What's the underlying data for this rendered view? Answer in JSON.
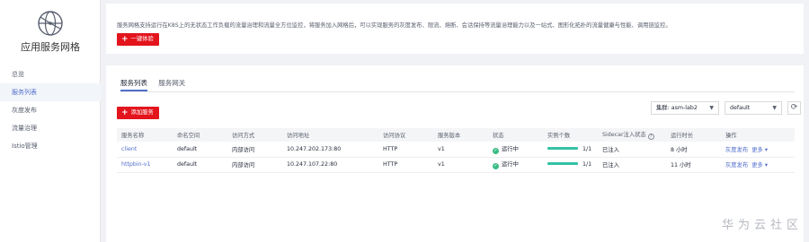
{
  "sidebar": {
    "title": "应用服务网格",
    "items": [
      {
        "label": "总览"
      },
      {
        "label": "服务列表",
        "active": true
      },
      {
        "label": "灰度发布"
      },
      {
        "label": "流量治理"
      },
      {
        "label": "Istio管理"
      }
    ]
  },
  "intro": {
    "description": "服务网格支持运行在K8S上的无状态工作负载的流量治理和流量全方位监控，将服务加入网格后，可以实现服务的灰度发布、限流、熔断、会话保持等流量治理能力以及一站式、图形化拓扑的流量健康与性能、调用链监控。",
    "trial_button": "一键体验"
  },
  "tabs": [
    {
      "label": "服务列表",
      "active": true
    },
    {
      "label": "服务网关"
    }
  ],
  "toolbar": {
    "add_button": "添加服务",
    "cluster_label": "集群:",
    "cluster_value": "asm-lab2",
    "namespace_value": "default",
    "refresh_icon": "refresh-icon"
  },
  "table": {
    "headers": [
      "服务名称",
      "命名空间",
      "访问方式",
      "访问地址",
      "访问协议",
      "服务版本",
      "状态",
      "实例个数",
      "Sidecar注入状态",
      "运行时长",
      "操作"
    ],
    "rows": [
      {
        "name": "client",
        "namespace": "default",
        "access": "内部访问",
        "address": "10.247.202.173:80",
        "protocol": "HTTP",
        "version": "v1",
        "status": "运行中",
        "instances": "1/1",
        "sidecar": "已注入",
        "uptime": "8 小时",
        "action1": "灰度发布",
        "action2": "更多"
      },
      {
        "name": "httpbin-v1",
        "namespace": "default",
        "access": "内部访问",
        "address": "10.247.107.22:80",
        "protocol": "HTTP",
        "version": "v1",
        "status": "运行中",
        "instances": "1/1",
        "sidecar": "已注入",
        "uptime": "11 小时",
        "action1": "灰度发布",
        "action2": "更多"
      }
    ]
  },
  "watermark": "华为云社区",
  "colors": {
    "accent": "#526ecc",
    "danger": "#e3141c",
    "success": "#3dbc85"
  }
}
